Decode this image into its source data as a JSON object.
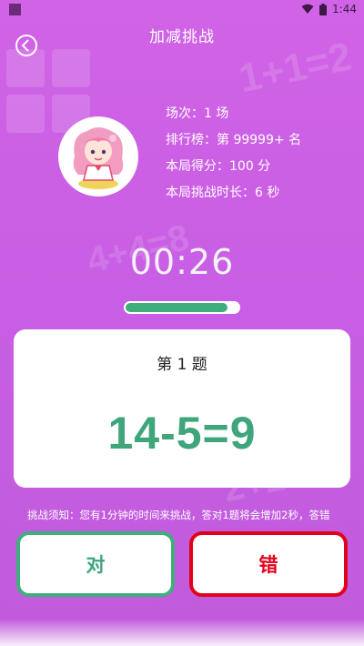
{
  "status_bar": {
    "time": "1:44"
  },
  "header": {
    "title": "加减挑战"
  },
  "background_decor": [
    "1+1=2",
    "4+4=8",
    "2+2=4"
  ],
  "stats": {
    "rank_count": "场次：1 场",
    "leaderboard": "排行榜：第 99999+ 名",
    "score": "本局得分：100 分",
    "duration": "本局挑战时长：6 秒"
  },
  "timer": {
    "value": "00:26"
  },
  "progress": {
    "fraction": 0.9
  },
  "question": {
    "label": "第 1 题",
    "expression": "14-5=9"
  },
  "notice": {
    "text": "挑战须知：您有1分钟的时间来挑战，答对1题将会增加2秒，答错"
  },
  "buttons": {
    "correct_label": "对",
    "wrong_label": "错"
  },
  "colors": {
    "background": "#c75ee3",
    "green": "#3fae7d",
    "red": "#e3001b",
    "text_dark": "#222222"
  }
}
